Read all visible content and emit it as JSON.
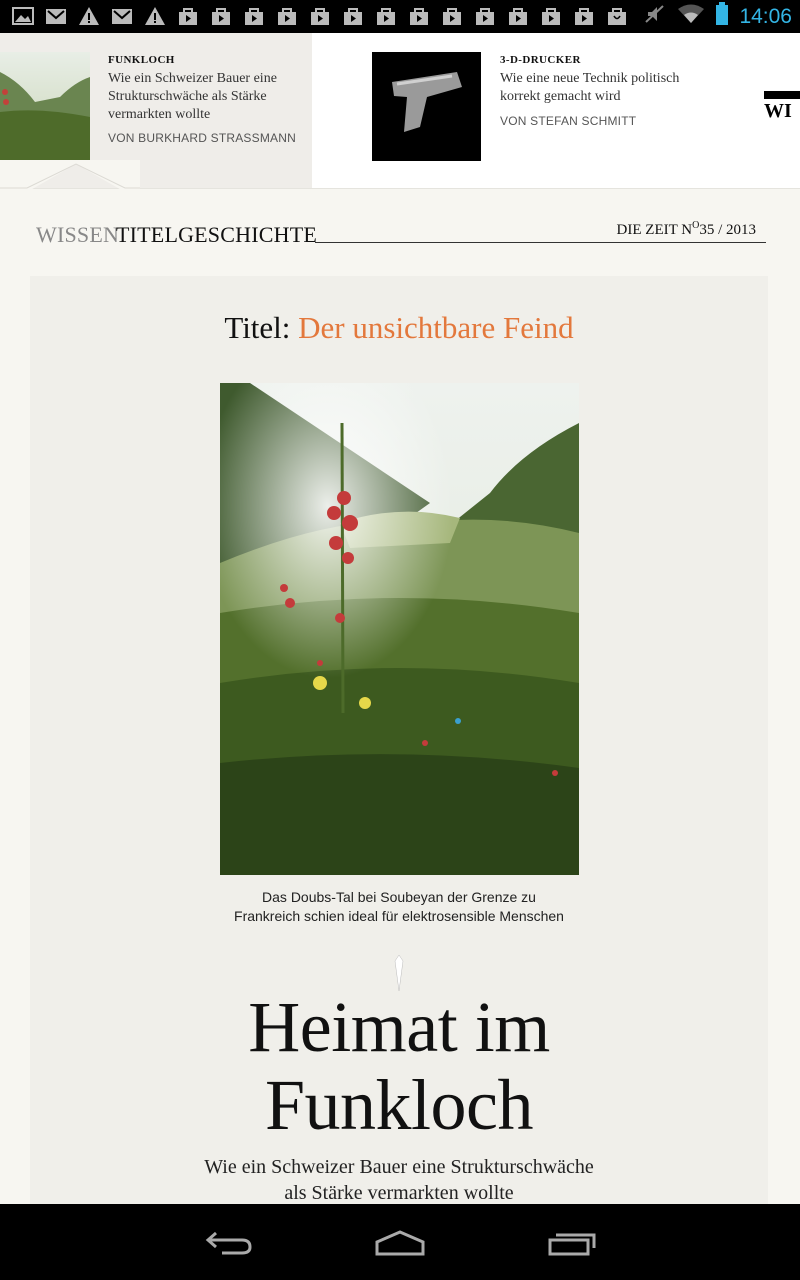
{
  "status_bar": {
    "time": "14:06",
    "notification_icons": [
      "gallery-icon",
      "gmail-icon",
      "warning-icon",
      "gmail-icon",
      "warning-icon",
      "shopping-bag-icon",
      "play-store-icon",
      "play-store-icon",
      "play-store-icon",
      "play-store-icon",
      "play-store-icon",
      "play-store-icon",
      "play-store-icon",
      "play-store-icon",
      "play-store-icon",
      "play-store-icon",
      "play-store-icon",
      "play-store-icon",
      "shopping-bag-icon"
    ],
    "system_icons": [
      "mute-icon",
      "wifi-icon",
      "battery-icon"
    ],
    "time_color": "#33b5e5"
  },
  "teasers": [
    {
      "kicker": "FUNKLOCH",
      "title": "Wie ein Schweizer Bauer eine Strukturschwäche als Stärke vermarkten wollte",
      "byline": "VON BURKHARD STRASSMANN"
    },
    {
      "kicker": "3-D-DRUCKER",
      "title": "Wie eine neue Technik politisch korrekt gemacht wird",
      "byline": "VON STEFAN SCHMITT"
    }
  ],
  "section": {
    "category": "WISSEN",
    "subcategory": "TITELGESCHICHTE",
    "issue_prefix": "DIE ZEIT N",
    "issue_sup": "O",
    "issue_suffix": "35 / 2013"
  },
  "article": {
    "heading_prefix": "Titel: ",
    "heading": "Der unsichtbare Feind",
    "caption_line1": "Das Doubs-Tal bei Soubeyan der Grenze zu",
    "caption_line2": "Frankreich schien ideal für elektrosensible Menschen",
    "title_line1": "Heimat im",
    "title_line2": "Funkloch",
    "subtitle_line1": "Wie ein Schweizer Bauer eine Strukturschwäche",
    "subtitle_line2": "als Stärke vermarkten wollte"
  },
  "colors": {
    "accent": "#e3783c",
    "background": "#f7f6f1",
    "card": "#f0efea"
  },
  "navigation": [
    "back-icon",
    "home-icon",
    "recent-apps-icon"
  ]
}
